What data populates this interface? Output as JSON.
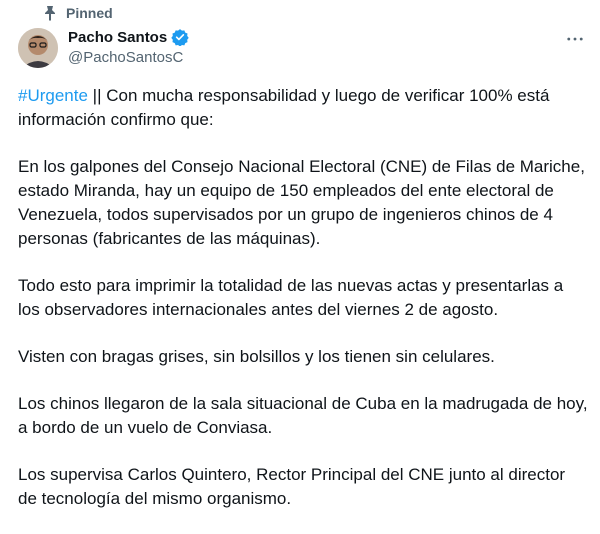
{
  "pinned": {
    "label": "Pinned",
    "icon": "pin-icon"
  },
  "author": {
    "display_name": "Pacho Santos",
    "handle": "@PachoSantosC",
    "verified_icon": "verified-badge-icon",
    "verified_color": "#1d9bf0"
  },
  "menu": {
    "icon": "more-options-icon"
  },
  "tweet": {
    "hashtag": "#Urgente",
    "intro": " || Con mucha responsabilidad y luego de verificar 100% está información confirmo que:",
    "p1": "En los galpones del Consejo Nacional Electoral (CNE) de Filas de Mariche, estado Miranda, hay un equipo de 150 empleados del ente electoral de Venezuela, todos supervisados por un grupo de ingenieros chinos de 4 personas (fabricantes de las máquinas).",
    "p2": "Todo esto para imprimir la totalidad de las nuevas actas y presentarlas a los observadores internacionales antes del viernes 2 de agosto.",
    "p3": "Visten con bragas grises, sin bolsillos y los tienen sin celulares.",
    "p4": "Los chinos llegaron de la sala situacional de Cuba en la madrugada de hoy, a bordo de un vuelo de Conviasa.",
    "p5": "Los supervisa Carlos Quintero, Rector Principal del CNE junto al director de tecnología del mismo organismo."
  },
  "colors": {
    "link": "#1d9bf0",
    "secondary_text": "#536471",
    "primary_text": "#0f1419"
  }
}
